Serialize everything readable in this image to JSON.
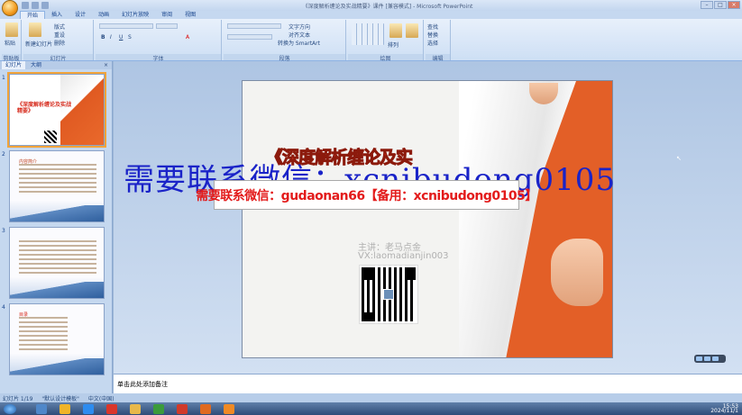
{
  "window": {
    "title": "《深度解析缠论及实战精要》课件 [兼容模式] - Microsoft PowerPoint",
    "controls": [
      "–",
      "□",
      "×"
    ]
  },
  "ribbon": {
    "tabs": [
      "开始",
      "插入",
      "设计",
      "动画",
      "幻灯片放映",
      "审阅",
      "视图"
    ],
    "active_tab": "开始",
    "groups": [
      {
        "label": "剪贴板",
        "items": [
          "粘贴"
        ]
      },
      {
        "label": "幻灯片",
        "items": [
          "新建幻灯片",
          "版式",
          "重设",
          "删除"
        ]
      },
      {
        "label": "字体",
        "items": [
          "B",
          "I",
          "U",
          "S",
          "A"
        ]
      },
      {
        "label": "段落",
        "items": [
          "文字方向",
          "对齐文本",
          "转换为 SmartArt"
        ]
      },
      {
        "label": "绘图",
        "items": [
          "排列",
          "快速样式"
        ]
      },
      {
        "label": "编辑",
        "items": [
          "查找",
          "替换",
          "选择"
        ]
      }
    ]
  },
  "left_panel": {
    "tabs": [
      "幻灯片",
      "大纲"
    ],
    "active_tab": "幻灯片",
    "close": "×",
    "thumbnails": [
      {
        "number": "1",
        "title": "《深度解析缠论及实战精要》",
        "selected": true
      },
      {
        "number": "2",
        "heading": "内容简介",
        "selected": false
      },
      {
        "number": "3",
        "heading": "",
        "selected": false
      },
      {
        "number": "4",
        "heading": "目录",
        "selected": false
      }
    ]
  },
  "slide": {
    "title": "《深度解析缠论及实",
    "teacher": "主讲：老马点金",
    "wechat": "VX:laomadianjin003"
  },
  "watermark": {
    "big": "需要联系微信：xcnibudong0105",
    "banner": "需要联系微信：gudaonan66【备用：xcnibudong0105】"
  },
  "notes": {
    "text": "单击此处添加备注"
  },
  "status_bar": {
    "slide_info": "幻灯片 1/19",
    "theme": "\"默认设计模板\"",
    "language": "中文(中国)"
  },
  "taskbar": {
    "time": "15:53",
    "date": "2024/11/1"
  },
  "colors": {
    "orange": "#e35f27",
    "title_red": "#e3331f",
    "watermark_blue": "#1a23c8",
    "banner_red": "#e31b1b"
  }
}
